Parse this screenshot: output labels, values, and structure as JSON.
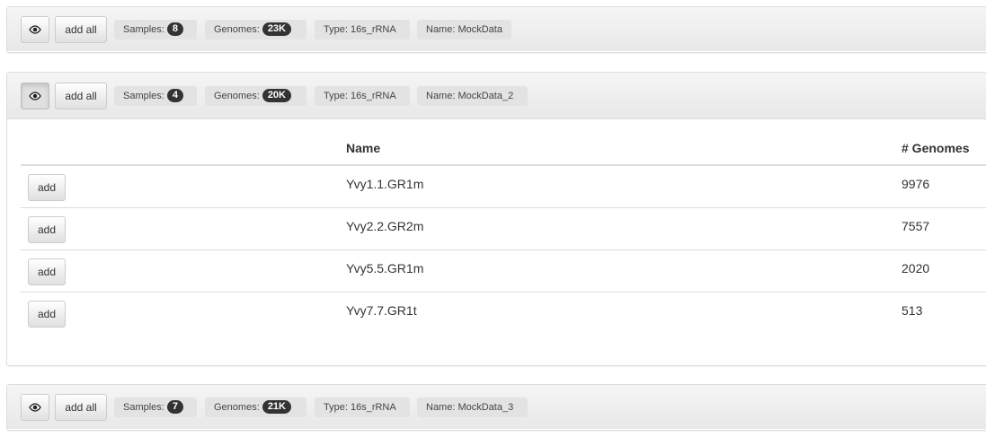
{
  "datasets": [
    {
      "eye_icon": "eye-icon",
      "add_all_label": "add all",
      "samples_label": "Samples:",
      "samples_count": "8",
      "genomes_label": "Genomes:",
      "genomes_count": "23K",
      "type_label": "Type: 16s_rRNA",
      "name_label": "Name: MockData",
      "expanded": false
    },
    {
      "eye_icon": "eye-icon",
      "add_all_label": "add all",
      "samples_label": "Samples:",
      "samples_count": "4",
      "genomes_label": "Genomes:",
      "genomes_count": "20K",
      "type_label": "Type: 16s_rRNA",
      "name_label": "Name: MockData_2",
      "expanded": true,
      "table": {
        "headers": [
          "",
          "Name",
          "# Genomes"
        ],
        "rows": [
          {
            "add_label": "add",
            "name": "Yvy1.1.GR1m",
            "genomes": "9976"
          },
          {
            "add_label": "add",
            "name": "Yvy2.2.GR2m",
            "genomes": "7557"
          },
          {
            "add_label": "add",
            "name": "Yvy5.5.GR1m",
            "genomes": "2020"
          },
          {
            "add_label": "add",
            "name": "Yvy7.7.GR1t",
            "genomes": "513"
          }
        ]
      }
    },
    {
      "eye_icon": "eye-icon",
      "add_all_label": "add all",
      "samples_label": "Samples:",
      "samples_count": "7",
      "genomes_label": "Genomes:",
      "genomes_count": "21K",
      "type_label": "Type: 16s_rRNA",
      "name_label": "Name: MockData_3",
      "expanded": false
    }
  ]
}
